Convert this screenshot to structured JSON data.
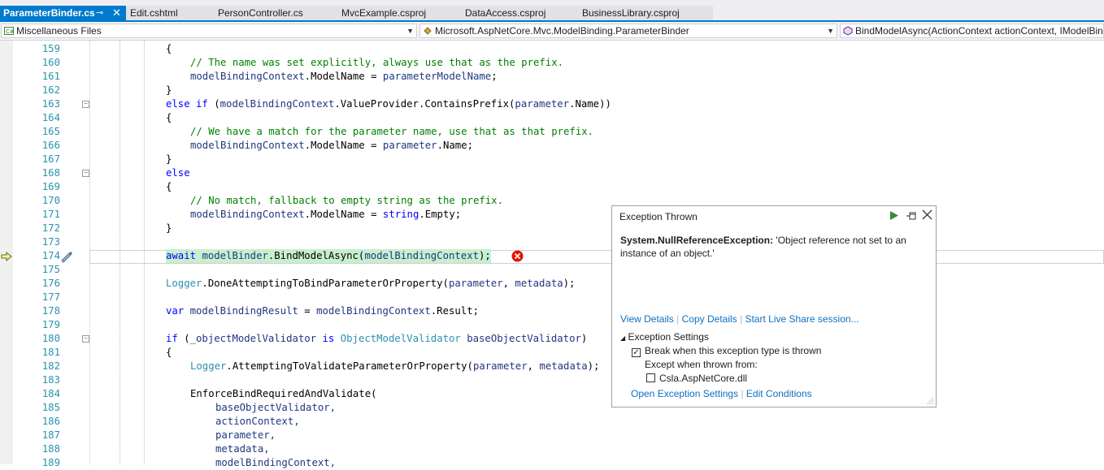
{
  "tabs": [
    {
      "label": "ParameterBinder.cs",
      "active": true
    },
    {
      "label": "Edit.cshtml"
    },
    {
      "label": "PersonController.cs"
    },
    {
      "label": "MvcExample.csproj"
    },
    {
      "label": "DataAccess.csproj"
    },
    {
      "label": "BusinessLibrary.csproj"
    }
  ],
  "nav": {
    "project": "Miscellaneous Files",
    "type": "Microsoft.AspNetCore.Mvc.ModelBinding.ParameterBinder",
    "member": "BindModelAsync(ActionContext actionContext, IModelBinder"
  },
  "line_numbers": [
    "159",
    "160",
    "161",
    "162",
    "163",
    "164",
    "165",
    "166",
    "167",
    "168",
    "169",
    "170",
    "171",
    "172",
    "173",
    "174",
    "175",
    "176",
    "177",
    "178",
    "179",
    "180",
    "181",
    "182",
    "183",
    "184",
    "185",
    "186",
    "187",
    "188",
    "189"
  ],
  "code": {
    "l160": "// The name was set explicitly, always use that as the prefix.",
    "l165": "// We have a match for the parameter name, use that as that prefix.",
    "l170": "// No match, fallback to empty string as the prefix."
  },
  "exception": {
    "title": "Exception Thrown",
    "type": "System.NullReferenceException:",
    "message": "'Object reference not set to an instance of an object.'",
    "view_details": "View Details",
    "copy_details": "Copy Details",
    "live_share": "Start Live Share session...",
    "settings_header": "Exception Settings",
    "break_when": "Break when this exception type is thrown",
    "except_when": "Except when thrown from:",
    "module": "Csla.AspNetCore.dll",
    "open_settings": "Open Exception Settings",
    "edit_conditions": "Edit Conditions"
  },
  "colors": {
    "accent": "#007acc",
    "comment": "#008000",
    "keyword": "#0000ff",
    "linenumber": "#2b91af",
    "highlight": "#c6efce",
    "error": "#e51400"
  }
}
